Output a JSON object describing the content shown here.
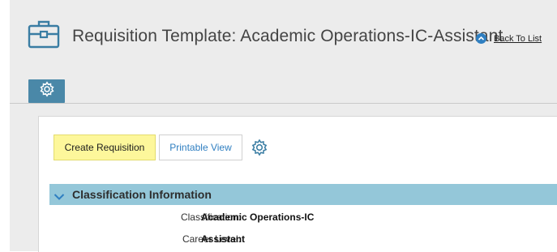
{
  "header": {
    "title": "Requisition Template: Academic Operations-IC-Assistant",
    "back_link": "Back To List",
    "icon": "briefcase-icon"
  },
  "tabs": [
    {
      "icon": "gear-icon",
      "active": true
    }
  ],
  "toolbar": {
    "create_label": "Create Requisition",
    "print_label": "Printable View",
    "settings_icon": "gear-icon"
  },
  "section": {
    "title": "Classification Information",
    "expanded": true,
    "fields": [
      {
        "label": "Classification:",
        "value": "Academic Operations-IC"
      },
      {
        "label": "Career Level:",
        "value": "Assistant"
      }
    ]
  },
  "colors": {
    "accent": "#4a88a8",
    "section_bar": "#94c7d9",
    "create_button": "#fdf79b",
    "link": "#2f7fc1"
  }
}
